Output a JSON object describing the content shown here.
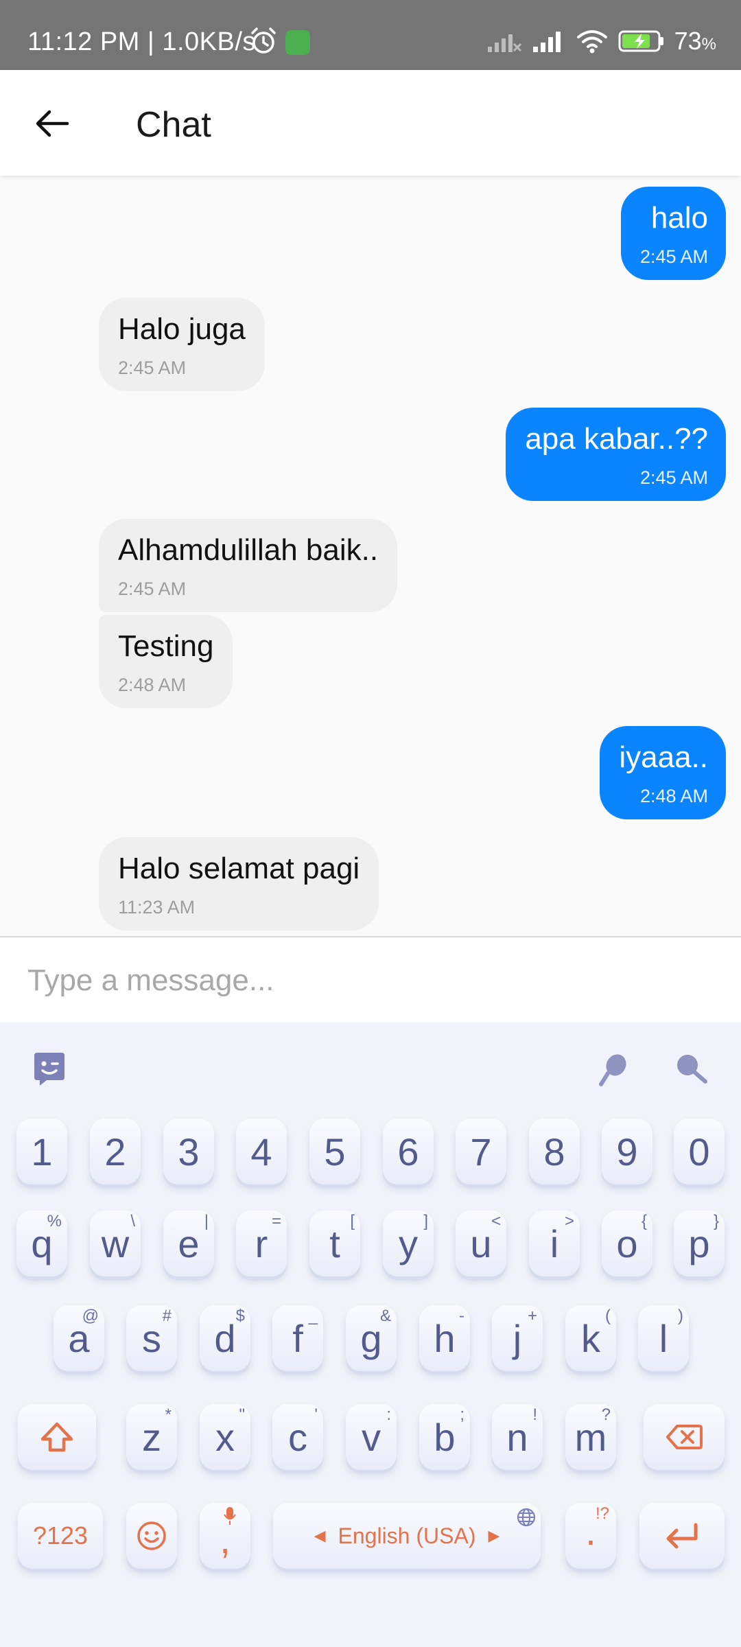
{
  "status_bar": {
    "time_speed": "11:12 PM | 1.0KB/s",
    "battery": "73",
    "battery_unit": "%"
  },
  "app_bar": {
    "title": "Chat",
    "back_icon": "arrow-left-icon"
  },
  "messages": [
    {
      "dir": "out",
      "text": "halo",
      "time": "2:45 AM"
    },
    {
      "dir": "in",
      "text": "Halo juga",
      "time": "2:45 AM"
    },
    {
      "dir": "out",
      "text": "apa kabar..??",
      "time": "2:45 AM"
    },
    {
      "dir": "in",
      "text": "Alhamdulillah baik..",
      "time": "2:45 AM"
    },
    {
      "dir": "in",
      "text": "Testing",
      "time": "2:48 AM"
    },
    {
      "dir": "out",
      "text": "iyaaa..",
      "time": "2:48 AM"
    },
    {
      "dir": "in",
      "text": "Halo selamat pagi",
      "time": "11:23 AM"
    }
  ],
  "composer": {
    "placeholder": "Type a message..."
  },
  "keyboard": {
    "numbers": [
      "1",
      "2",
      "3",
      "4",
      "5",
      "6",
      "7",
      "8",
      "9",
      "0"
    ],
    "row1": [
      {
        "k": "q",
        "s": "%"
      },
      {
        "k": "w",
        "s": "\\"
      },
      {
        "k": "e",
        "s": "|"
      },
      {
        "k": "r",
        "s": "="
      },
      {
        "k": "t",
        "s": "["
      },
      {
        "k": "y",
        "s": "]"
      },
      {
        "k": "u",
        "s": "<"
      },
      {
        "k": "i",
        "s": ">"
      },
      {
        "k": "o",
        "s": "{"
      },
      {
        "k": "p",
        "s": "}"
      }
    ],
    "row2": [
      {
        "k": "a",
        "s": "@"
      },
      {
        "k": "s",
        "s": "#"
      },
      {
        "k": "d",
        "s": "$"
      },
      {
        "k": "f",
        "s": "_"
      },
      {
        "k": "g",
        "s": "&"
      },
      {
        "k": "h",
        "s": "-"
      },
      {
        "k": "j",
        "s": "+"
      },
      {
        "k": "k",
        "s": "("
      },
      {
        "k": "l",
        "s": ")"
      }
    ],
    "row3": [
      {
        "k": "z",
        "s": "*"
      },
      {
        "k": "x",
        "s": "\""
      },
      {
        "k": "c",
        "s": "'"
      },
      {
        "k": "v",
        "s": ":"
      },
      {
        "k": "b",
        "s": ";"
      },
      {
        "k": "n",
        "s": "!"
      },
      {
        "k": "m",
        "s": "?"
      }
    ],
    "symbols_label": "?123",
    "comma": ",",
    "space_label": "English (USA)",
    "period": ".",
    "period_sup": "!?",
    "accent_color": "#e4724b",
    "key_text_color": "#535a8c"
  }
}
